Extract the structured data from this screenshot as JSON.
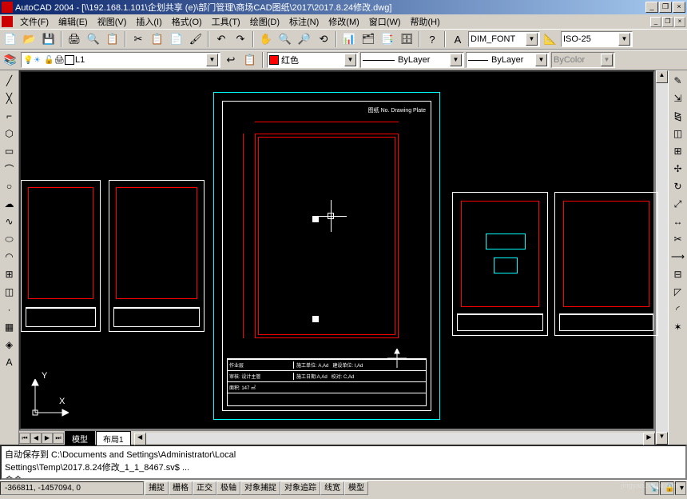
{
  "title_bar": {
    "app": "AutoCAD 2004",
    "file_path": "[\\\\192.168.1.101\\企划共享 (e)\\部门管理\\商场CAD图纸\\2017\\2017.8.24修改.dwg]"
  },
  "menu": {
    "file": "文件(F)",
    "edit": "编辑(E)",
    "view": "视图(V)",
    "insert": "插入(I)",
    "format": "格式(O)",
    "tools": "工具(T)",
    "draw": "绘图(D)",
    "dimension": "标注(N)",
    "modify": "修改(M)",
    "window": "窗口(W)",
    "help": "帮助(H)"
  },
  "text_style": {
    "selected": "DIM_FONT"
  },
  "dim_style": {
    "selected": "ISO-25"
  },
  "layer": {
    "selected": "L1"
  },
  "color": {
    "selected": "红色",
    "swatch": "#ff0000"
  },
  "linetype": {
    "selected": "ByLayer"
  },
  "lineweight": {
    "selected": "ByLayer"
  },
  "plotstyle": {
    "selected": "ByColor"
  },
  "tabs": {
    "model": "模型",
    "layout1": "布局1"
  },
  "ucs": {
    "x": "X",
    "y": "Y"
  },
  "command": {
    "line1": "自动保存到 C:\\Documents and Settings\\Administrator\\Local",
    "line2": "Settings\\Temp\\2017.8.24修改_1_1_8467.sv$ ...",
    "prompt": "命令:"
  },
  "status": {
    "coords": "-366811, -1457094, 0",
    "snap": "捕捉",
    "grid": "栅格",
    "ortho": "正交",
    "polar": "极轴",
    "osnap": "对象捕捉",
    "otrack": "对象追踪",
    "lwt": "线宽",
    "model": "模型"
  },
  "watermark": {
    "main": "Baidu 经验",
    "sub": "jingyan.baidu.com"
  }
}
